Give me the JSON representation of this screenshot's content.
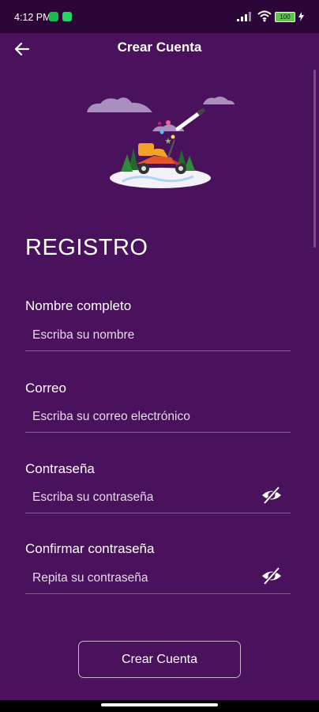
{
  "status_bar": {
    "time": "4:12 PM",
    "battery": "100"
  },
  "app_bar": {
    "title": "Crear Cuenta",
    "back_icon": "arrow-left-icon"
  },
  "form": {
    "heading": "REGISTRO",
    "fields": [
      {
        "label": "Nombre completo",
        "placeholder": "Escriba su nombre",
        "value": ""
      },
      {
        "label": "Correo",
        "placeholder": "Escriba su correo electrónico",
        "value": ""
      },
      {
        "label": "Contraseña",
        "placeholder": "Escriba su contraseña",
        "value": "",
        "toggle_icon": "eye-off-icon"
      },
      {
        "label": "Confirmar contraseña",
        "placeholder": "Repita su contraseña",
        "value": "",
        "toggle_icon": "eye-off-icon"
      }
    ],
    "submit_label": "Crear Cuenta"
  },
  "colors": {
    "background": "#4a115c",
    "status_bar": "#2b0637",
    "accent_orange": "#f2a12a",
    "battery": "#62c44a"
  }
}
